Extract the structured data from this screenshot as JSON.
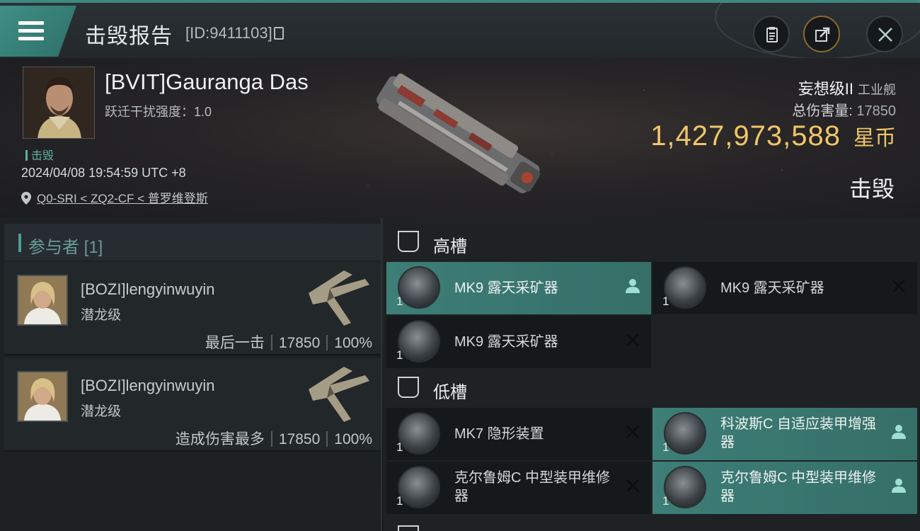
{
  "header": {
    "title": "击毁报告",
    "report_id": "[ID:9411103]"
  },
  "victim": {
    "name": "[BVIT]Gauranga Das",
    "warp_disruption": "跃迁干扰强度：1.0",
    "tag": "击毁",
    "timestamp": "2024/04/08 19:54:59 UTC +8",
    "location": "Q0-SRI < ZQ2-CF < 普罗维登斯",
    "ship_name": "妄想级II",
    "ship_class": "工业舰",
    "total_damage_label": "总伤害量:",
    "total_damage": "17850",
    "isk_value": "1,427,973,588",
    "isk_unit": "星币",
    "status": "击毁"
  },
  "participants": {
    "heading": "参与者 [1]",
    "rows": [
      {
        "name": "[BOZI]lengyinwuyin",
        "ship": "潜龙级",
        "role": "最后一击",
        "damage": "17850",
        "percent": "100%"
      },
      {
        "name": "[BOZI]lengyinwuyin",
        "ship": "潜龙级",
        "role": "造成伤害最多",
        "damage": "17850",
        "percent": "100%"
      }
    ]
  },
  "fitting": {
    "high_slots_label": "高槽",
    "low_slots_label": "低槽",
    "high_slots": [
      {
        "name": "MK9 露天采矿器",
        "qty": "1",
        "state": "dropped"
      },
      {
        "name": "MK9 露天采矿器",
        "qty": "1",
        "state": "destroyed"
      },
      {
        "name": "MK9 露天采矿器",
        "qty": "1",
        "state": "destroyed"
      }
    ],
    "low_slots": [
      {
        "name": "MK7 隐形装置",
        "qty": "1",
        "state": "destroyed"
      },
      {
        "name": "科波斯C 自适应装甲增强器",
        "qty": "1",
        "state": "dropped"
      },
      {
        "name": "克尔鲁姆C 中型装甲维修器",
        "qty": "1",
        "state": "destroyed"
      },
      {
        "name": "克尔鲁姆C 中型装甲维修器",
        "qty": "1",
        "state": "dropped"
      }
    ]
  },
  "colors": {
    "accent": "#3f8f86",
    "isk_gold": "#f0c56a",
    "dropped_highlight": "#3d7e76"
  }
}
